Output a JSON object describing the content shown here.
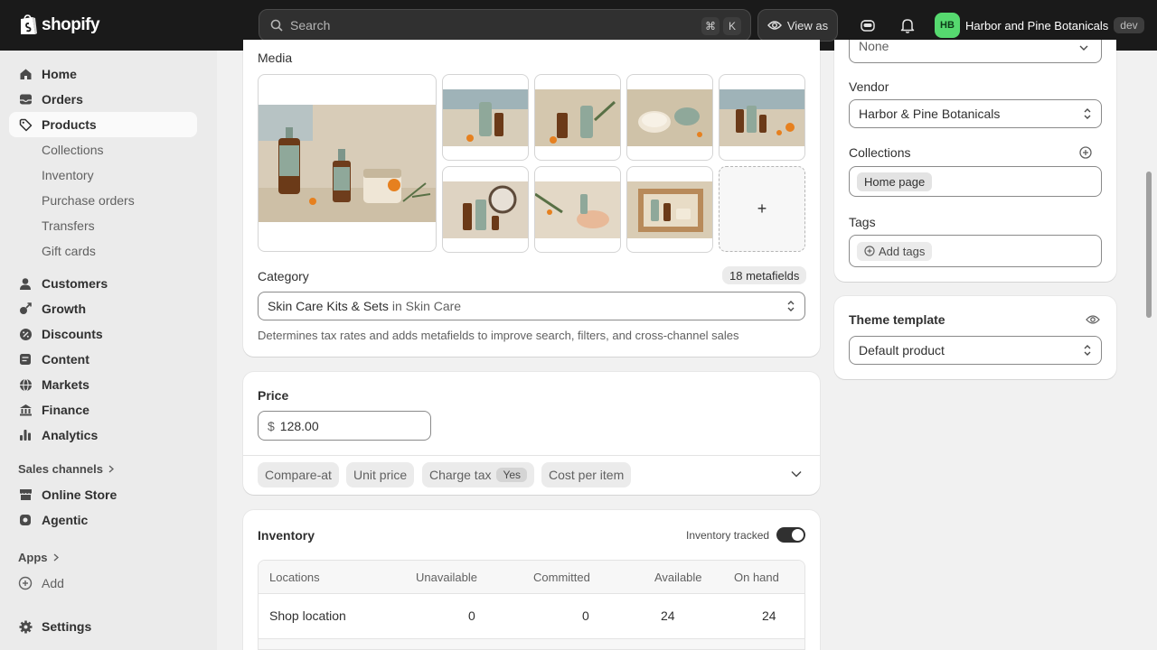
{
  "topbar": {
    "logo_text": "shopify",
    "search_placeholder": "Search",
    "shortcut_cmd": "⌘",
    "shortcut_key": "K",
    "view_as_label": "View as",
    "store_initials": "HB",
    "store_name": "Harbor and Pine Botanicals",
    "env_badge": "dev"
  },
  "sidebar": {
    "primary": [
      {
        "label": "Home",
        "icon": "home-icon"
      },
      {
        "label": "Orders",
        "icon": "inbox-icon"
      },
      {
        "label": "Products",
        "icon": "tag-icon"
      }
    ],
    "product_sub": [
      "Collections",
      "Inventory",
      "Purchase orders",
      "Transfers",
      "Gift cards"
    ],
    "secondary": [
      {
        "label": "Customers",
        "icon": "person-icon"
      },
      {
        "label": "Growth",
        "icon": "growth-icon"
      },
      {
        "label": "Discounts",
        "icon": "discount-icon"
      },
      {
        "label": "Content",
        "icon": "content-icon"
      },
      {
        "label": "Markets",
        "icon": "globe-icon"
      },
      {
        "label": "Finance",
        "icon": "bank-icon"
      },
      {
        "label": "Analytics",
        "icon": "bar-chart-icon"
      }
    ],
    "sales_channels_label": "Sales channels",
    "channels": [
      {
        "label": "Online Store",
        "icon": "store-icon"
      },
      {
        "label": "Agentic",
        "icon": "agentic-icon"
      }
    ],
    "apps_label": "Apps",
    "add_label": "Add",
    "settings_label": "Settings"
  },
  "media": {
    "title": "Media",
    "add_symbol": "+"
  },
  "category": {
    "label": "Category",
    "metafields_badge": "18 metafields",
    "value": "Skin Care Kits & Sets",
    "value_context": "in Skin Care",
    "help": "Determines tax rates and adds metafields to improve search, filters, and cross-channel sales"
  },
  "price": {
    "title": "Price",
    "currency": "$",
    "value": "128.00",
    "pills": [
      "Compare-at",
      "Unit price",
      "Charge tax",
      "Cost per item"
    ],
    "charge_tax_value": "Yes"
  },
  "inventory": {
    "title": "Inventory",
    "tracked_label": "Inventory tracked",
    "tracked": true,
    "columns": [
      "Locations",
      "Unavailable",
      "Committed",
      "Available",
      "On hand"
    ],
    "rows": [
      {
        "location": "Shop location",
        "unavailable": "0",
        "committed": "0",
        "available": "24",
        "on_hand": "24"
      }
    ]
  },
  "organization": {
    "type_value": "None",
    "vendor_label": "Vendor",
    "vendor_value": "Harbor & Pine Botanicals",
    "collections_label": "Collections",
    "collection_tag": "Home page",
    "tags_label": "Tags",
    "add_tags_label": "Add tags"
  },
  "theme": {
    "title": "Theme template",
    "value": "Default product"
  },
  "colors": {
    "topbar": "#1a1a1a",
    "sidebar": "#ebebeb",
    "page": "#f1f1f1",
    "avatar": "#56d96f"
  }
}
